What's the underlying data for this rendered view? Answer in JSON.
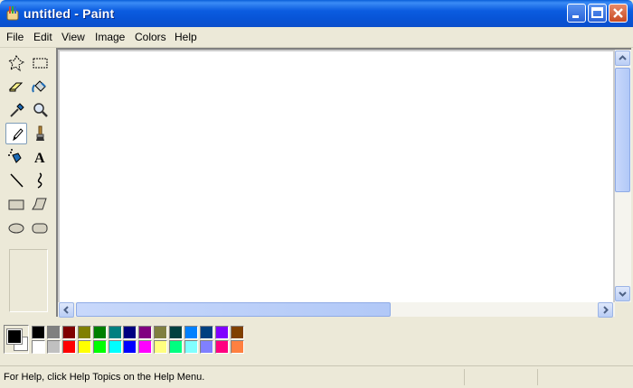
{
  "window": {
    "title": "untitled - Paint"
  },
  "menu": {
    "items": [
      "File",
      "Edit",
      "View",
      "Image",
      "Colors",
      "Help"
    ]
  },
  "tools": [
    {
      "name": "free-form-select-icon"
    },
    {
      "name": "rectangle-select-icon"
    },
    {
      "name": "eraser-icon"
    },
    {
      "name": "fill-bucket-icon"
    },
    {
      "name": "color-picker-icon"
    },
    {
      "name": "magnifier-icon"
    },
    {
      "name": "pencil-icon",
      "selected": true
    },
    {
      "name": "brush-icon"
    },
    {
      "name": "airbrush-icon"
    },
    {
      "name": "text-tool-icon",
      "glyph": "A"
    },
    {
      "name": "line-icon"
    },
    {
      "name": "curve-icon"
    },
    {
      "name": "rectangle-icon"
    },
    {
      "name": "polygon-icon"
    },
    {
      "name": "ellipse-icon"
    },
    {
      "name": "rounded-rectangle-icon"
    }
  ],
  "palette": {
    "foreground": "#000000",
    "background": "#ffffff",
    "row1": [
      "#000000",
      "#808080",
      "#800000",
      "#808000",
      "#008000",
      "#008080",
      "#000080",
      "#800080",
      "#808040",
      "#004040",
      "#0080ff",
      "#004080",
      "#8000ff",
      "#804000"
    ],
    "row2": [
      "#ffffff",
      "#c0c0c0",
      "#ff0000",
      "#ffff00",
      "#00ff00",
      "#00ffff",
      "#0000ff",
      "#ff00ff",
      "#ffff80",
      "#00ff80",
      "#80ffff",
      "#8080ff",
      "#ff0080",
      "#ff8040"
    ]
  },
  "status": {
    "help_text": "For Help, click Help Topics on the Help Menu."
  }
}
